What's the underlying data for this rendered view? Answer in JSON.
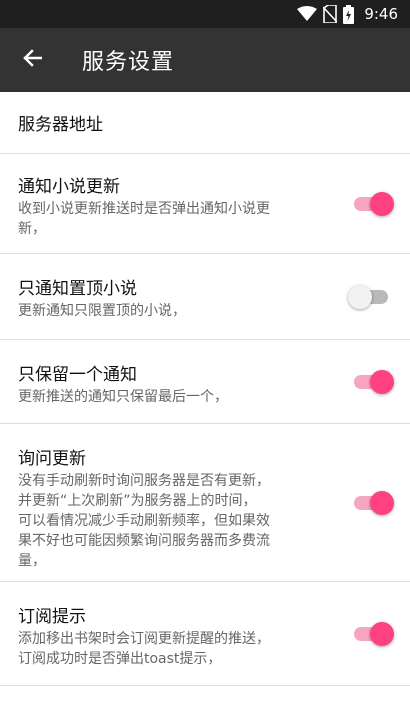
{
  "status_bar": {
    "time": "9:46",
    "icons": [
      "wifi-icon",
      "no-sim-icon",
      "battery-charging-icon"
    ]
  },
  "toolbar": {
    "back_icon": "arrow-left-icon",
    "title": "服务设置"
  },
  "settings": [
    {
      "title": "服务器地址"
    },
    {
      "title": "通知小说更新",
      "summary": "收到小说更新推送时是否弹出通知小说更\n新，",
      "checked": true
    },
    {
      "title": "只通知置顶小说",
      "summary": "更新通知只限置顶的小说，",
      "checked": false
    },
    {
      "title": "只保留一个通知",
      "summary": "更新推送的通知只保留最后一个，",
      "checked": true
    },
    {
      "title": "询问更新",
      "summary": "没有手动刷新时询问服务器是否有更新，\n并更新“上次刷新”为服务器上的时间，\n可以看情况减少手动刷新频率，但如果效\n果不好也可能因频繁询问服务器而多费流\n量，",
      "checked": true
    },
    {
      "title": "订阅提示",
      "summary": "添加移出书架时会订阅更新提醒的推送，\n订阅成功时是否弹出toast提示，",
      "checked": true
    }
  ],
  "colors": {
    "accent": "#ff4081",
    "toolbar": "#333333",
    "status_bar": "#1f1f1f"
  }
}
